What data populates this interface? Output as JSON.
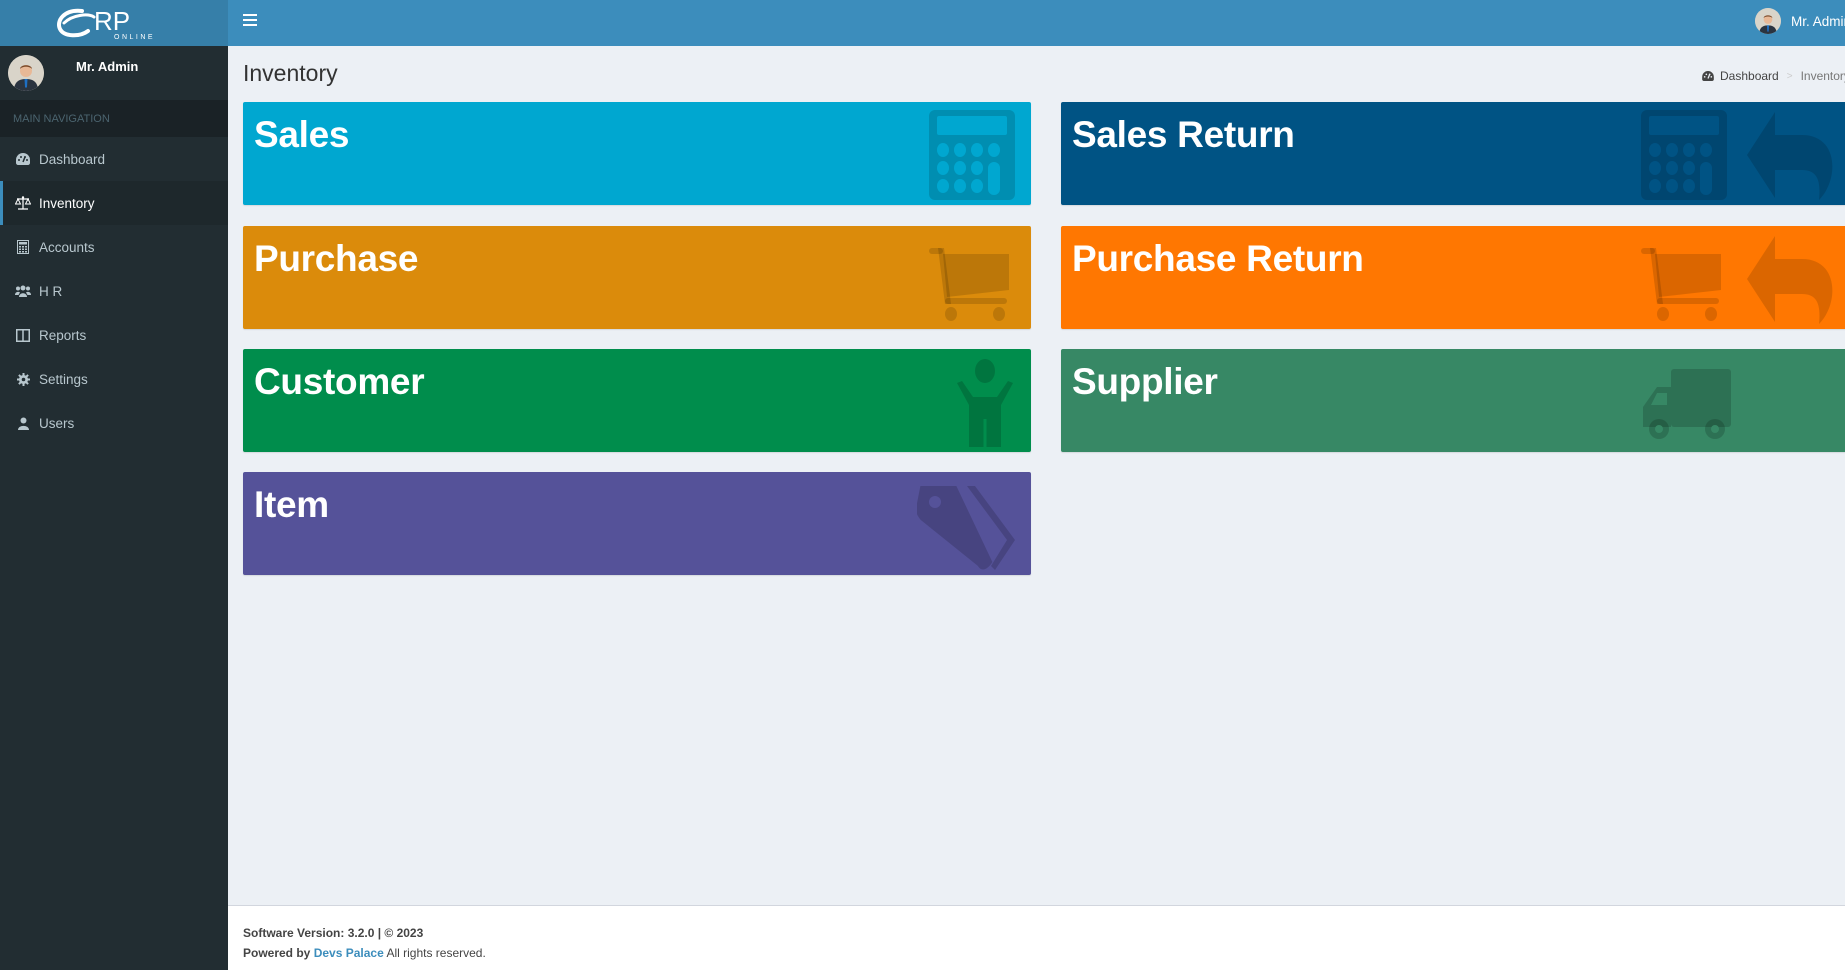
{
  "app": {
    "logo_text": "RP",
    "logo_subtext": "ONLINE",
    "user_name": "Mr. Admin"
  },
  "sidebar": {
    "header": "MAIN NAVIGATION",
    "items": [
      {
        "label": "Dashboard",
        "icon": "dashboard-icon",
        "active": false
      },
      {
        "label": "Inventory",
        "icon": "balance-scale-icon",
        "active": true
      },
      {
        "label": "Accounts",
        "icon": "calculator-icon",
        "active": false
      },
      {
        "label": "H R",
        "icon": "users-icon",
        "active": false
      },
      {
        "label": "Reports",
        "icon": "columns-icon",
        "active": false
      },
      {
        "label": "Settings",
        "icon": "gear-icon",
        "active": false
      },
      {
        "label": "Users",
        "icon": "user-icon",
        "active": false
      }
    ]
  },
  "header": {
    "menu_toggle": "hamburger-icon",
    "user_name": "Mr. Admin"
  },
  "page": {
    "title": "Inventory",
    "breadcrumb": {
      "home": "Dashboard",
      "separator": ">",
      "current": "Inventory"
    }
  },
  "tiles": [
    {
      "label": "Sales",
      "color": "#00a7d0",
      "icons": [
        "calculator-icon"
      ]
    },
    {
      "label": "Sales Return",
      "color": "#005384",
      "icons": [
        "calculator-icon",
        "reply-icon"
      ]
    },
    {
      "label": "Purchase",
      "color": "#db8b0b",
      "icons": [
        "shopping-cart-icon"
      ]
    },
    {
      "label": "Purchase Return",
      "color": "#ff7701",
      "icons": [
        "shopping-cart-icon",
        "reply-icon"
      ]
    },
    {
      "label": "Customer",
      "color": "#008d4c",
      "icons": [
        "child-icon"
      ]
    },
    {
      "label": "Supplier",
      "color": "#378865",
      "icons": [
        "truck-icon"
      ]
    },
    {
      "label": "Item",
      "color": "#555299",
      "icons": [
        "tags-icon"
      ]
    }
  ],
  "footer": {
    "version_text": "Software Version: 3.2.0 | © 2023",
    "powered_by": "Powered by",
    "company": "Devs Palace",
    "rights": "All rights reserved."
  }
}
